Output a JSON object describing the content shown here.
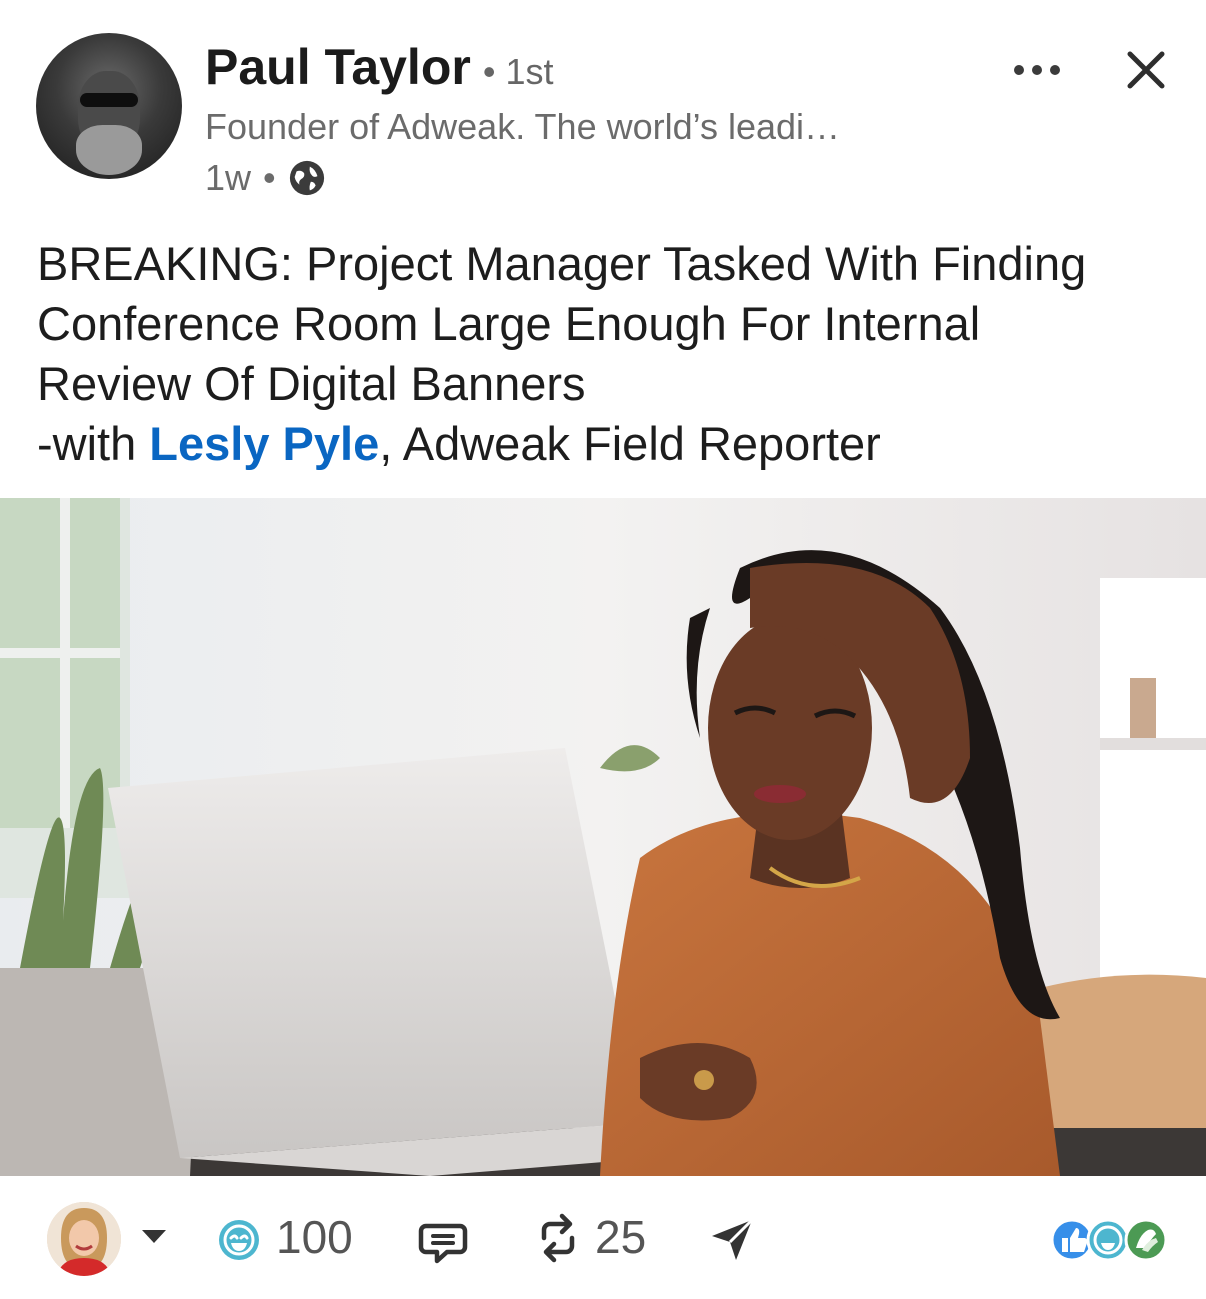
{
  "post": {
    "author": {
      "name": "Paul Taylor",
      "degree": "1st",
      "headline": "Founder of Adweak. The world’s leadi…",
      "time": "1w",
      "separator": "•",
      "visibility_icon": "globe-icon"
    },
    "actions": {
      "more_icon": "more-icon",
      "close_icon": "close-icon"
    },
    "text": {
      "line1": "BREAKING: Project Manager Tasked With Finding",
      "line2": "Conference Room Large Enough For Internal",
      "line3": "Review Of Digital Banners",
      "line4_prefix": "-with ",
      "mention": "Lesly Pyle",
      "line4_suffix": ", Adweak Field Reporter"
    },
    "image": {
      "icon": "post-photo"
    }
  },
  "footer": {
    "reaction_count": "100",
    "repost_count": "25",
    "icons": {
      "reaction": "funny-reaction-icon",
      "comment": "comment-icon",
      "repost": "repost-icon",
      "send": "send-icon",
      "summary": "reactions-summary-icons"
    }
  },
  "colors": {
    "accent_blue": "#0a66c2",
    "text_primary": "#1d1d1d",
    "text_secondary": "#6b6b6b"
  }
}
